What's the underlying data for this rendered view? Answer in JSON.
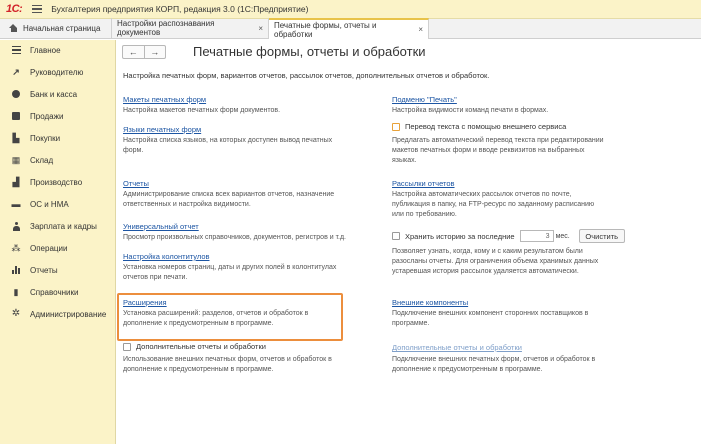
{
  "app": {
    "logo": "1С:",
    "title": "Бухгалтерия предприятия КОРП, редакция 3.0  (1С:Предприятие)"
  },
  "tabs": {
    "home": "Начальная страница",
    "open": [
      {
        "label": "Настройки распознавания документов",
        "close": "×"
      },
      {
        "label": "Печатные формы, отчеты и обработки",
        "close": "×"
      }
    ]
  },
  "sidebar": {
    "items": [
      {
        "label": "Главное",
        "icon": "menu-icon"
      },
      {
        "label": "Руководителю",
        "icon": "trend-icon"
      },
      {
        "label": "Банк и касса",
        "icon": "coin-icon"
      },
      {
        "label": "Продажи",
        "icon": "bag-icon"
      },
      {
        "label": "Покупки",
        "icon": "cart-icon"
      },
      {
        "label": "Склад",
        "icon": "warehouse-icon"
      },
      {
        "label": "Производство",
        "icon": "factory-icon"
      },
      {
        "label": "ОС и НМА",
        "icon": "truck-icon"
      },
      {
        "label": "Зарплата и кадры",
        "icon": "person-icon"
      },
      {
        "label": "Операции",
        "icon": "operations-icon"
      },
      {
        "label": "Отчеты",
        "icon": "chart-icon"
      },
      {
        "label": "Справочники",
        "icon": "book-icon"
      },
      {
        "label": "Администрирование",
        "icon": "gear-icon"
      }
    ]
  },
  "page": {
    "back": "←",
    "forward": "→",
    "title": "Печатные формы, отчеты и обработки",
    "subtitle": "Настройка печатных форм, вариантов отчетов, рассылок отчетов, дополнительных отчетов и обработок."
  },
  "left": {
    "makety": {
      "link": "Макеты печатных форм",
      "desc": "Настройка макетов печатных форм документов."
    },
    "yazyki": {
      "link": "Языки печатных форм",
      "desc1": "Настройка списка языков, на которых доступен вывод печатных",
      "desc2": "форм."
    },
    "otchety": {
      "link": "Отчеты",
      "desc1": "Администрирование списка всех вариантов отчетов, назначение",
      "desc2": "ответственных и настройка видимости."
    },
    "universal": {
      "link": "Универсальный отчет",
      "desc": "Просмотр произвольных справочников, документов, регистров и т.д."
    },
    "kolontituly": {
      "link": "Настройка колонтитулов",
      "desc1": "Установка номеров страниц, даты и других полей в колонтитулах",
      "desc2": "отчетов при печати."
    },
    "rasshireniya": {
      "link": "Расширения",
      "desc1": "Установка расширений: разделов, отчетов и обработок в",
      "desc2": "дополнение к предусмотренным в программе."
    },
    "dop": {
      "label": "Дополнительные отчеты и обработки",
      "desc1": "Использование внешних печатных форм, отчетов и обработок в",
      "desc2": "дополнение к предусмотренным в программе."
    }
  },
  "right": {
    "podmenu": {
      "link": "Подменю \"Печать\"",
      "desc": "Настройка видимости команд печати в формах."
    },
    "perevod": {
      "label": "Перевод текста с помощью внешнего сервиса",
      "desc1": "Предлагать автоматический перевод текста при редактировании",
      "desc2": "макетов печатных форм и вводе реквизитов на выбранных",
      "desc3": "языках."
    },
    "rassylki": {
      "link": "Рассылки отчетов",
      "desc1": "Настройка автоматических рассылок отчетов по почте,",
      "desc2": "публикация в папку, на FTP-ресурс по заданному расписанию",
      "desc3": "или по требованию."
    },
    "history": {
      "label": "Хранить историю за последние",
      "value": "3",
      "unit": "мес.",
      "button": "Очистить",
      "desc1": "Позволяет узнать, когда, кому и с каким результатом были",
      "desc2": "разосланы отчеты. Для ограничения объема хранимых данных",
      "desc3": "устаревшая история рассылок удаляется автоматически."
    },
    "vneshnie": {
      "link": "Внешние компоненты",
      "desc1": "Подключение внешних компонент сторонних поставщиков в",
      "desc2": "программе."
    },
    "dop": {
      "link": "Дополнительные отчеты и обработки",
      "desc1": "Подключение внешних печатных форм, отчетов и обработок в",
      "desc2": "дополнение к предусмотренным в программе."
    }
  },
  "colors": {
    "brand_red": "#d2232a",
    "panel_yellow": "#fbf3c8",
    "link_blue": "#1c55a3",
    "highlight_orange": "#ec8e3d"
  }
}
